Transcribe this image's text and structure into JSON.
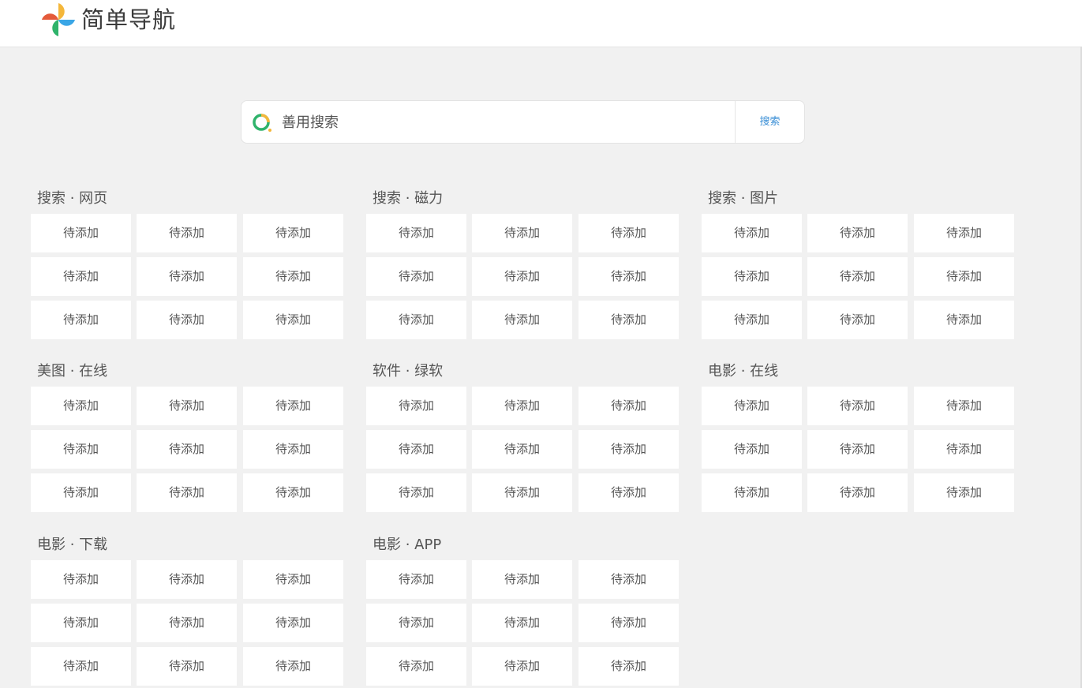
{
  "header": {
    "site_title": "简单导航",
    "logo_icon": "pinwheel-logo-icon"
  },
  "search": {
    "engine_icon": "search-engine-ring-icon",
    "placeholder": "善用搜索",
    "value": "",
    "button_label": "搜索"
  },
  "categories": [
    {
      "title": "搜索 · 网页",
      "items": [
        "待添加",
        "待添加",
        "待添加",
        "待添加",
        "待添加",
        "待添加",
        "待添加",
        "待添加",
        "待添加"
      ]
    },
    {
      "title": "搜索 · 磁力",
      "items": [
        "待添加",
        "待添加",
        "待添加",
        "待添加",
        "待添加",
        "待添加",
        "待添加",
        "待添加",
        "待添加"
      ]
    },
    {
      "title": "搜索 · 图片",
      "items": [
        "待添加",
        "待添加",
        "待添加",
        "待添加",
        "待添加",
        "待添加",
        "待添加",
        "待添加",
        "待添加"
      ]
    },
    {
      "title": "美图 · 在线",
      "items": [
        "待添加",
        "待添加",
        "待添加",
        "待添加",
        "待添加",
        "待添加",
        "待添加",
        "待添加",
        "待添加"
      ]
    },
    {
      "title": "软件 · 绿软",
      "items": [
        "待添加",
        "待添加",
        "待添加",
        "待添加",
        "待添加",
        "待添加",
        "待添加",
        "待添加",
        "待添加"
      ]
    },
    {
      "title": "电影 · 在线",
      "items": [
        "待添加",
        "待添加",
        "待添加",
        "待添加",
        "待添加",
        "待添加",
        "待添加",
        "待添加",
        "待添加"
      ]
    },
    {
      "title": "电影 · 下载",
      "items": [
        "待添加",
        "待添加",
        "待添加",
        "待添加",
        "待添加",
        "待添加",
        "待添加",
        "待添加",
        "待添加"
      ]
    },
    {
      "title": "电影 · APP",
      "items": [
        "待添加",
        "待添加",
        "待添加",
        "待添加",
        "待添加",
        "待添加",
        "待添加",
        "待添加",
        "待添加"
      ]
    }
  ],
  "colors": {
    "accent": "#3b8fd6",
    "background": "#f1f1f1",
    "tile": "#ffffff"
  }
}
